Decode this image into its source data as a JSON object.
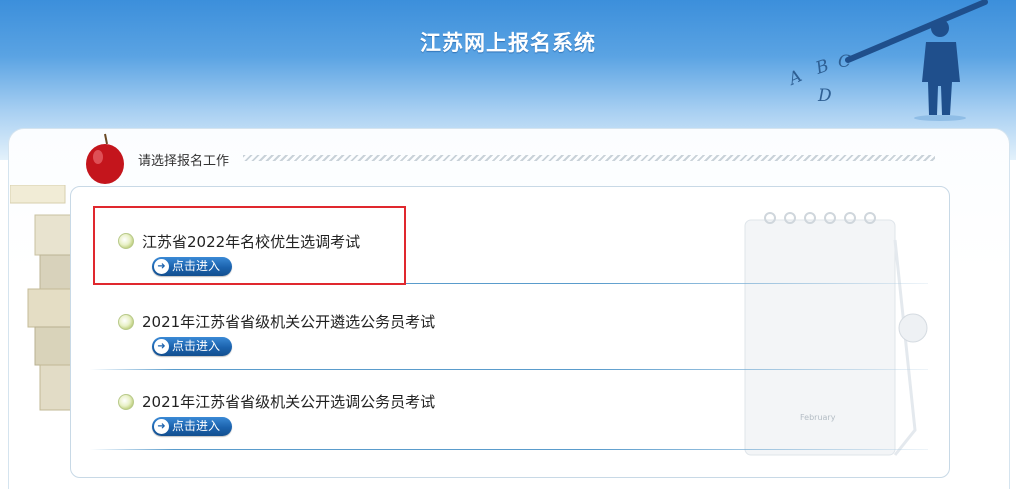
{
  "header": {
    "title": "江苏网上报名系统"
  },
  "section": {
    "label": "请选择报名工作"
  },
  "exams": [
    {
      "title": "江苏省2022年名校优生选调考试",
      "button": "点击进入"
    },
    {
      "title": "2021年江苏省省级机关公开遴选公务员考试",
      "button": "点击进入"
    },
    {
      "title": "2021年江苏省省级机关公开选调公务员考试",
      "button": "点击进入"
    }
  ],
  "decor": {
    "abc_letters": [
      "A",
      "B",
      "C",
      "D"
    ],
    "calendar_month": "February"
  },
  "colors": {
    "header": "#4a97dd",
    "button": "#1b62ad",
    "highlight": "#e0282e"
  }
}
